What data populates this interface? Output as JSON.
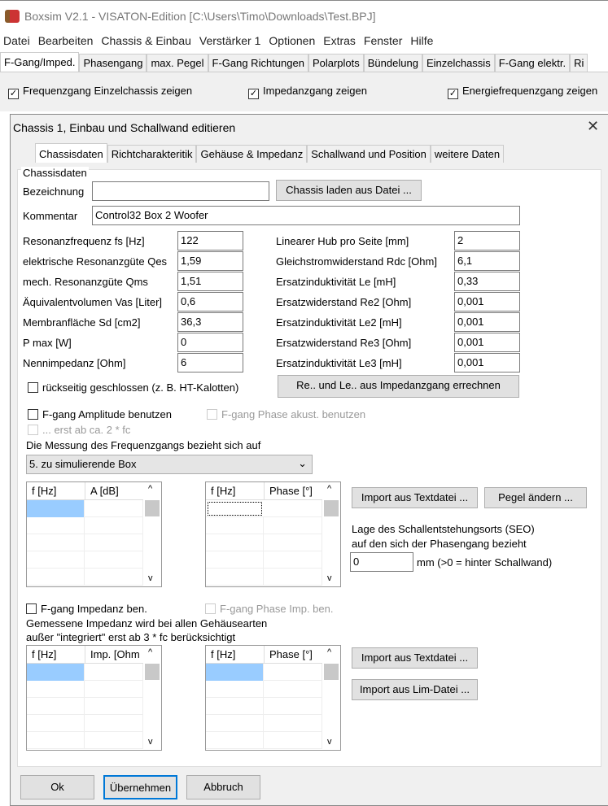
{
  "app": {
    "title": "Boxsim V2.1 - VISATON-Edition [C:\\Users\\Timo\\Downloads\\Test.BPJ]"
  },
  "menu": [
    "Datei",
    "Bearbeiten",
    "Chassis & Einbau",
    "Verstärker 1",
    "Optionen",
    "Extras",
    "Fenster",
    "Hilfe"
  ],
  "tabs": [
    "F-Gang/Imped.",
    "Phasengang",
    "max. Pegel",
    "F-Gang Richtungen",
    "Polarplots",
    "Bündelung",
    "Einzelchassis",
    "F-Gang elektr.",
    "Ri"
  ],
  "options": {
    "freq_single": "Frequenzgang Einzelchassis zeigen",
    "impedance": "Impedanzgang zeigen",
    "energy": "Energiefrequenzgang zeigen"
  },
  "dialog": {
    "title": "Chassis 1, Einbau und Schallwand editieren",
    "tabs": [
      "Chassisdaten",
      "Richtcharakteritik",
      "Gehäuse & Impedanz",
      "Schallwand und Position",
      "weitere Daten"
    ],
    "group_title": "Chassisdaten",
    "bezeichnung_label": "Bezeichnung",
    "bezeichnung_value": "",
    "load_button": "Chassis laden aus Datei ...",
    "kommentar_label": "Kommentar",
    "kommentar_value": "Control32 Box 2 Woofer",
    "left_params": [
      {
        "label": "Resonanzfrequenz fs [Hz]",
        "value": "122"
      },
      {
        "label": "elektrische Resonanzgüte Qes",
        "value": "1,59"
      },
      {
        "label": "mech. Resonanzgüte Qms",
        "value": "1,51"
      },
      {
        "label": "Äquivalentvolumen Vas [Liter]",
        "value": "0,6"
      },
      {
        "label": "Membranfläche Sd [cm2]",
        "value": "36,3"
      },
      {
        "label": "P max  [W]",
        "value": "0"
      },
      {
        "label": "Nennimpedanz  [Ohm]",
        "value": "6"
      }
    ],
    "right_params": [
      {
        "label": "Linearer Hub pro Seite [mm]",
        "value": "2"
      },
      {
        "label": "Gleichstromwiderstand Rdc [Ohm]",
        "value": "6,1"
      },
      {
        "label": "Ersatzinduktivität Le [mH]",
        "value": "0,33"
      },
      {
        "label": "Ersatzwiderstand Re2 [Ohm]",
        "value": "0,001"
      },
      {
        "label": "Ersatzinduktivität Le2 [mH]",
        "value": "0,001"
      },
      {
        "label": "Ersatzwiderstand Re3 [Ohm]",
        "value": "0,001"
      },
      {
        "label": "Ersatzinduktivität Le3 [mH]",
        "value": "0,001"
      }
    ],
    "closed_back": "rückseitig geschlossen (z. B. HT-Kalotten)",
    "calc_button": "Re.. und Le.. aus Impedanzgang errechnen",
    "fgang_amp": "F-gang Amplitude benutzen",
    "fgang_phase": "F-gang Phase akust. benutzen",
    "from_fc": "... erst ab ca. 2 * fc",
    "measure_ref": "Die Messung des Frequenzgangs bezieht sich auf",
    "measure_select": "5. zu simulierende Box",
    "grid1": [
      "f [Hz]",
      "A [dB]"
    ],
    "grid2": [
      "f [Hz]",
      "Phase [°]"
    ],
    "grid3": [
      "f [Hz]",
      "Imp. [Ohm"
    ],
    "grid4": [
      "f [Hz]",
      "Phase [°]"
    ],
    "import_text": "Import aus Textdatei ...",
    "pegel": "Pegel ändern ...",
    "seo_line1": "Lage des Schallentstehungsorts (SEO)",
    "seo_line2": "auf den sich der Phasengang bezieht",
    "seo_value": "0",
    "seo_unit": "mm  (>0 = hinter Schallwand)",
    "fgang_imp": "F-gang Impedanz ben.",
    "fgang_phase_imp": "F-gang Phase Imp. ben.",
    "imp_note1": "Gemessene Impedanz wird bei allen Gehäusearten",
    "imp_note2": "außer \"integriert\" erst ab 3 * fc berücksichtigt",
    "import_text2": "Import aus Textdatei ...",
    "import_lim": "Import aus Lim-Datei ...",
    "ok": "Ok",
    "apply": "Übernehmen",
    "cancel": "Abbruch"
  }
}
